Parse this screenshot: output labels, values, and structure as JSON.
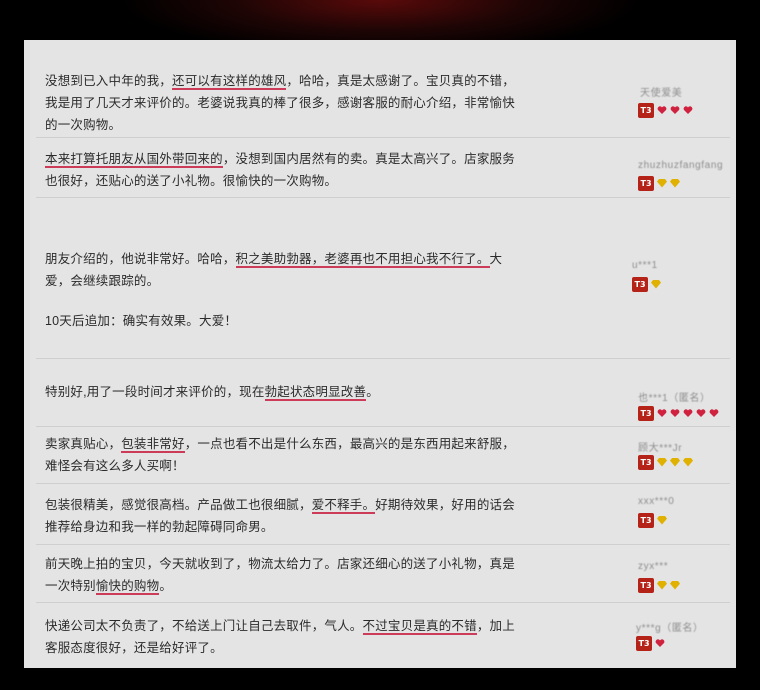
{
  "colors": {
    "highlight": "#cc3b57",
    "badge_red": "#b52318",
    "heart": "#d0213f",
    "diamond": "#e0b100"
  },
  "badge_label": "T3",
  "reviews": [
    {
      "segments": [
        {
          "t": "没想到已入中年的我，"
        },
        {
          "t": "还可以有这样的雄风",
          "hl": true
        },
        {
          "t": "，哈哈，真是太感谢了。宝贝真的不错，我是用了几天才来评价的。老婆说我真的棒了很多，感谢客服的耐心介绍，非常愉快的一次购物。"
        }
      ],
      "extra": "",
      "user": "天使爱美",
      "rank_icon": "heart-icon",
      "rank_count": 3
    },
    {
      "segments": [
        {
          "t": "本来打算托朋友从国外带回来的",
          "hl": true
        },
        {
          "t": "，没想到国内居然有的卖。真是太高兴了。店家服务也很好，还贴心的送了小礼物。很愉快的一次购物。"
        }
      ],
      "extra": "",
      "user": "zhuzhuzfangfang",
      "rank_icon": "diamond-icon",
      "rank_count": 2
    },
    {
      "segments": [
        {
          "t": "朋友介绍的，他说非常好。哈哈，"
        },
        {
          "t": "积之美助勃器，老婆再也不用担心我不行了。",
          "hl": true
        },
        {
          "t": "大爱，会继续跟踪的。"
        }
      ],
      "extra": "10天后追加：确实有效果。大爱！",
      "user": "u***1",
      "rank_icon": "diamond-icon",
      "rank_count": 1
    },
    {
      "segments": [
        {
          "t": "特别好,用了一段时间才来评价的，现在"
        },
        {
          "t": "勃起状态明显改善",
          "hl": true
        },
        {
          "t": "。"
        }
      ],
      "extra": "",
      "user": "也***1（匿名）",
      "rank_icon": "heart-icon",
      "rank_count": 5
    },
    {
      "segments": [
        {
          "t": "卖家真贴心，"
        },
        {
          "t": "包装非常好",
          "hl": true
        },
        {
          "t": "，一点也看不出是什么东西，最高兴的是东西用起来舒服，难怪会有这么多人买啊！"
        }
      ],
      "extra": "",
      "user": "顾大***Jr",
      "rank_icon": "diamond-icon",
      "rank_count": 3
    },
    {
      "segments": [
        {
          "t": "包装很精美，感觉很高档。产品做工也很细腻，"
        },
        {
          "t": "爱不释手。",
          "hl": true
        },
        {
          "t": "好期待效果，好用的话会推荐给身边和我一样的勃起障碍同命男。"
        }
      ],
      "extra": "",
      "user": "xxx***0",
      "rank_icon": "diamond-icon",
      "rank_count": 1
    },
    {
      "segments": [
        {
          "t": "前天晚上拍的宝贝，今天就收到了，物流太给力了。店家还细心的送了小礼物，真是一次特别"
        },
        {
          "t": "愉快的购物",
          "hl": true
        },
        {
          "t": "。"
        }
      ],
      "extra": "",
      "user": "zyx***",
      "rank_icon": "diamond-icon",
      "rank_count": 2
    },
    {
      "segments": [
        {
          "t": "快递公司太不负责了，不给送上门让自己去取件，气人。"
        },
        {
          "t": "不过宝贝是真的不错",
          "hl": true
        },
        {
          "t": "，加上客服态度很好，还是给好评了。"
        }
      ],
      "extra": "",
      "user": "y***g（匿名）",
      "rank_icon": "heart-icon",
      "rank_count": 1
    }
  ]
}
